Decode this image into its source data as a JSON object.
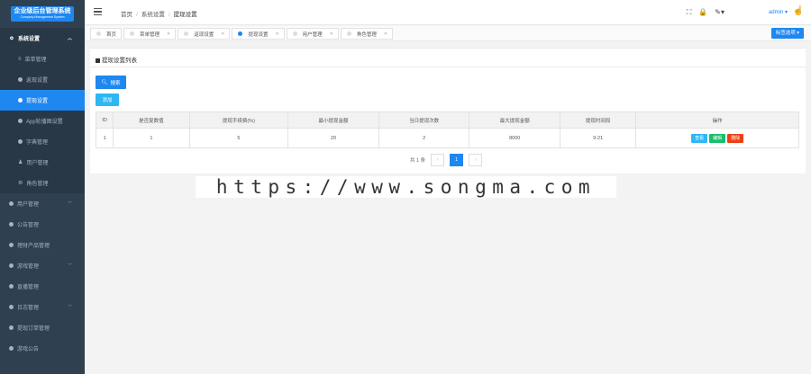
{
  "app": {
    "logo_title": "企业级后台管理系统",
    "logo_subtitle": "Company Management System"
  },
  "sidebar": {
    "groups": [
      {
        "label": "系统设置",
        "icon": "gear-icon",
        "expanded": true,
        "children": [
          {
            "label": "菜单管理",
            "icon": "list-icon"
          },
          {
            "label": "返现设置",
            "icon": "dot-icon"
          },
          {
            "label": "提现设置",
            "icon": "dot-icon",
            "active": true
          },
          {
            "label": "App轮播图设置",
            "icon": "dot-icon"
          },
          {
            "label": "字典管理",
            "icon": "dot-icon"
          },
          {
            "label": "用户管理",
            "icon": "user-icon"
          },
          {
            "label": "角色管理",
            "icon": "role-icon"
          }
        ]
      },
      {
        "label": "用户管理",
        "icon": "dot-icon",
        "has_children": true
      },
      {
        "label": "公告管理",
        "icon": "dot-icon"
      },
      {
        "label": "理财产品管理",
        "icon": "dot-icon"
      },
      {
        "label": "游戏管理",
        "icon": "dot-icon",
        "has_children": true
      },
      {
        "label": "直播管理",
        "icon": "dot-icon"
      },
      {
        "label": "日志管理",
        "icon": "dot-icon",
        "has_children": true
      },
      {
        "label": "提现订单管理",
        "icon": "dot-icon"
      },
      {
        "label": "游戏公告",
        "icon": "dot-icon"
      }
    ]
  },
  "header": {
    "breadcrumb": [
      "首页",
      "系统设置",
      "提现设置"
    ],
    "user": "admin"
  },
  "tabs": {
    "items": [
      {
        "label": "首页",
        "closable": false
      },
      {
        "label": "菜单管理",
        "closable": true
      },
      {
        "label": "返现设置",
        "closable": true
      },
      {
        "label": "提现设置",
        "closable": true,
        "active": true
      },
      {
        "label": "用户管理",
        "closable": true
      },
      {
        "label": "角色管理",
        "closable": true
      }
    ],
    "action_label": "标签选项"
  },
  "panel": {
    "title": "提现设置列表",
    "search_label": "搜索",
    "add_label": "添加",
    "columns": [
      "ID",
      "是否复数值",
      "提现手续费(%)",
      "最小提现金额",
      "当日提现次数",
      "最大提现金额",
      "提现时间段",
      "操作"
    ],
    "rows": [
      {
        "cells": [
          "1",
          "1",
          "5",
          "20",
          "2",
          "8000",
          "9-21"
        ]
      }
    ],
    "row_actions": [
      "查看",
      "编辑",
      "删除"
    ],
    "pagination": {
      "total_text": "共 1 条",
      "current_page": "1"
    }
  },
  "watermark": "https://www.songma.com",
  "colors": {
    "accent": "#1e87f0",
    "sidebar": "#2f4050",
    "view": "#2db7f5",
    "edit": "#19be6b",
    "delete": "#ed4014"
  }
}
